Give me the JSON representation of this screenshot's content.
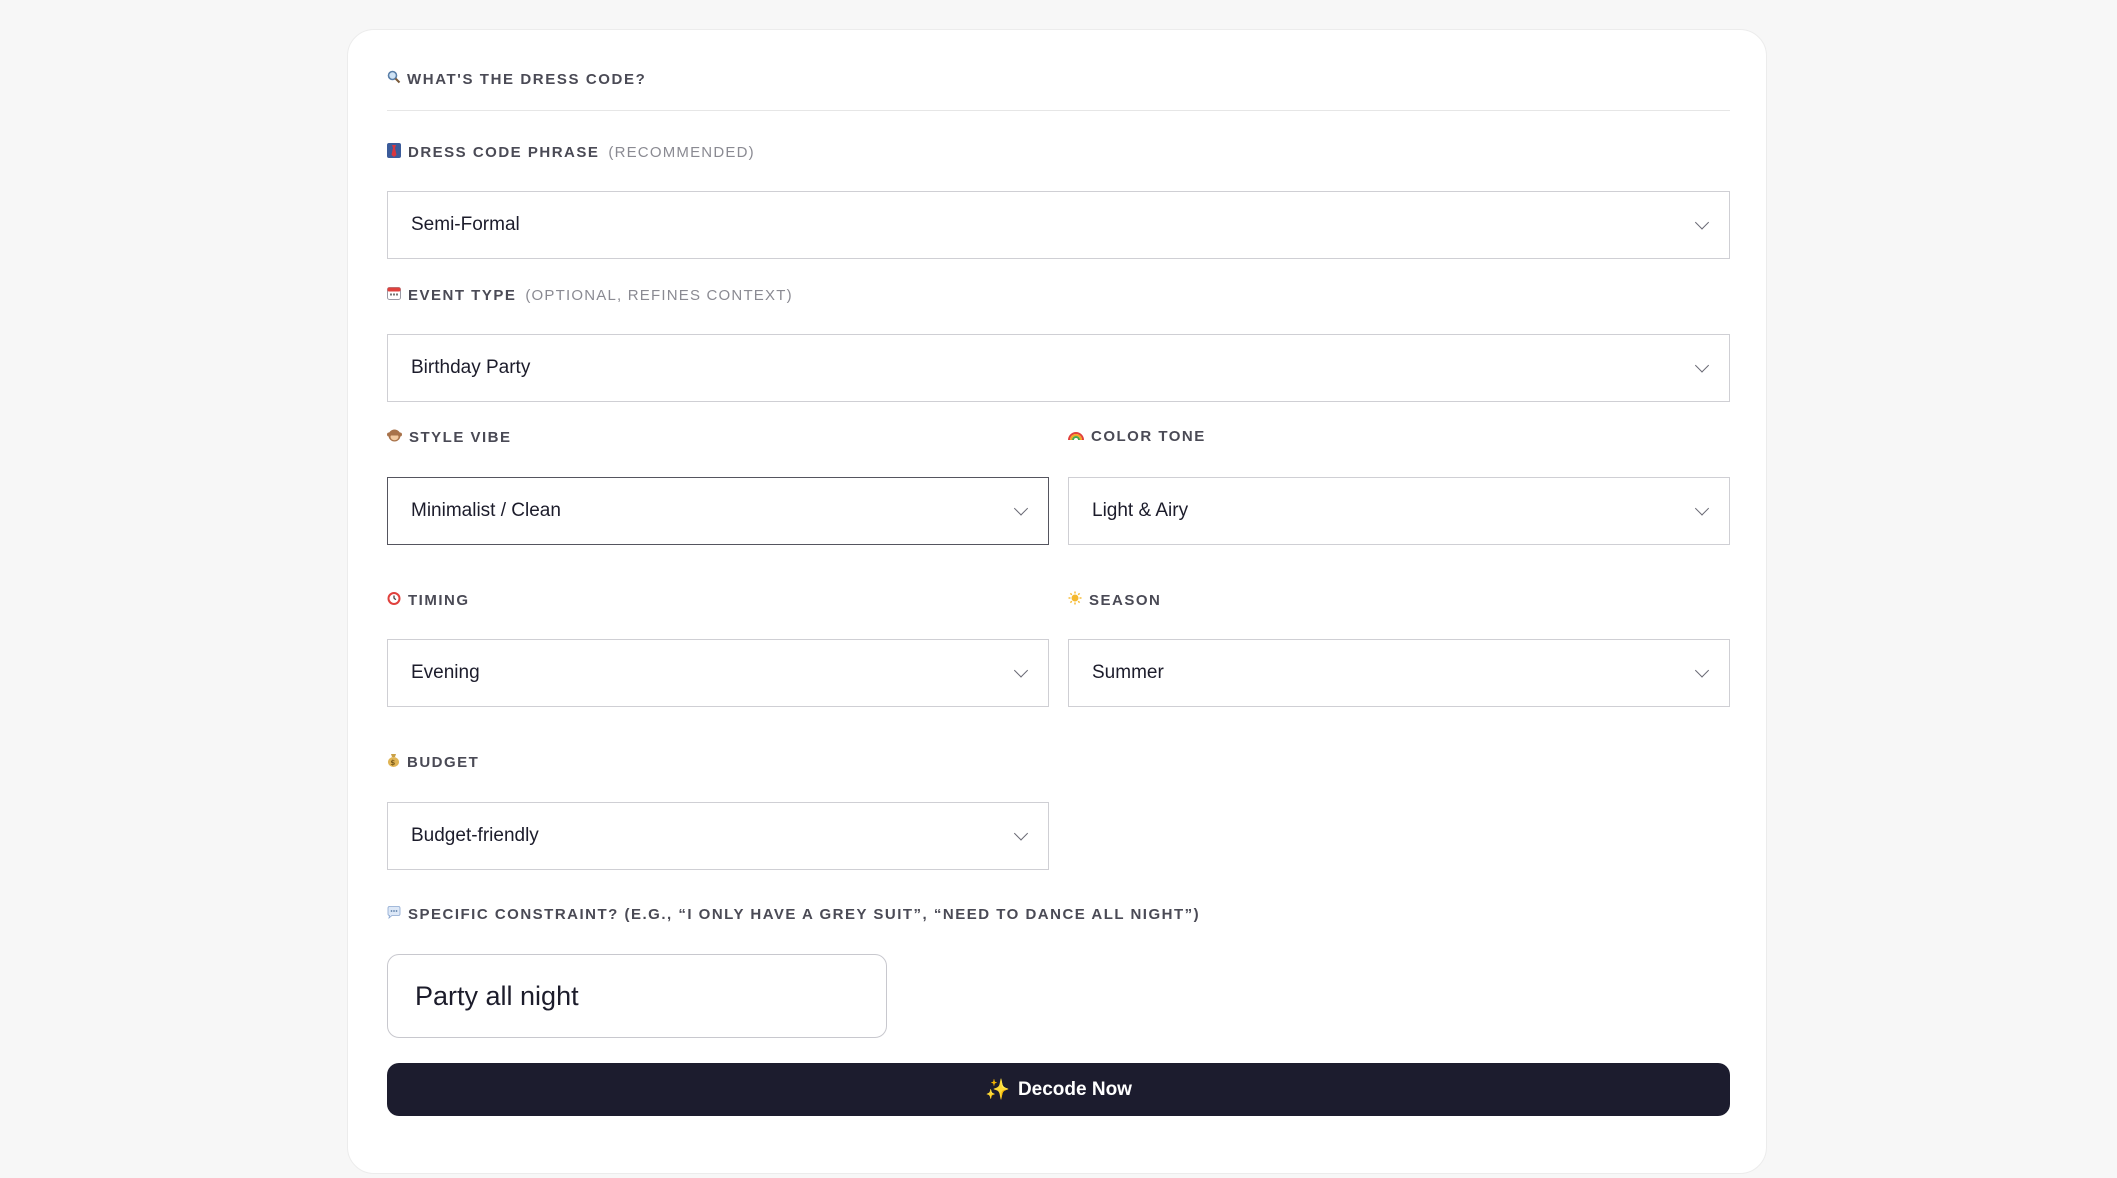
{
  "section": {
    "title": "WHAT'S THE DRESS CODE?",
    "icon": "magnifier-icon"
  },
  "fields": {
    "dress_code": {
      "label": "DRESS CODE PHRASE",
      "hint": "(RECOMMENDED)",
      "icon": "necktie-icon",
      "value": "Semi-Formal"
    },
    "event_type": {
      "label": "EVENT TYPE",
      "hint": "(OPTIONAL, REFINES CONTEXT)",
      "icon": "calendar-icon",
      "value": "Birthday Party"
    },
    "style_vibe": {
      "label": "STYLE VIBE",
      "icon": "monkey-icon",
      "value": "Minimalist / Clean"
    },
    "color_tone": {
      "label": "COLOR TONE",
      "icon": "rainbow-icon",
      "value": "Light & Airy"
    },
    "timing": {
      "label": "TIMING",
      "icon": "alarm-clock-icon",
      "value": "Evening"
    },
    "season": {
      "label": "SEASON",
      "icon": "sun-icon",
      "value": "Summer"
    },
    "budget": {
      "label": "BUDGET",
      "icon": "money-bag-icon",
      "value": "Budget-friendly"
    },
    "constraint": {
      "label": "SPECIFIC CONSTRAINT? (E.G., “I ONLY HAVE A GREY SUIT”, “NEED TO DANCE ALL NIGHT”)",
      "icon": "speech-bubble-icon",
      "value": "Party all night"
    }
  },
  "action": {
    "label": "Decode Now",
    "icon": "sparkles-icon"
  },
  "colors": {
    "button_bg": "#1c1c2e",
    "page_bg": "#f7f7f7",
    "card_bg": "#ffffff"
  }
}
